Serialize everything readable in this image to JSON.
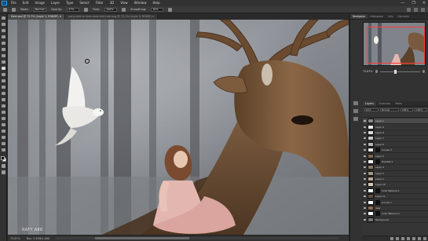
{
  "app": {
    "logo": "Ps",
    "menu": [
      "File",
      "Edit",
      "Image",
      "Layer",
      "Type",
      "Select",
      "Filter",
      "3D",
      "View",
      "Window",
      "Help"
    ],
    "window_controls": [
      "—",
      "❐",
      "✕"
    ]
  },
  "options_bar": {
    "mode_label": "Mode:",
    "mode_value": "Normal",
    "opacity_label": "Opacity:",
    "opacity_value": "47%",
    "flow_label": "Flow:",
    "flow_value": "100%",
    "smoothing_label": "Smoothing:",
    "smoothing_value": "10%"
  },
  "tabs": [
    {
      "label": "Deer.psd @ 75.7% (Layer 1, RGB/8*) ×",
      "active": true
    },
    {
      "label": "peng-bird-on-tree-dove-bird-tree.png @ 73.1% (Layer 0, RGB/8) ×",
      "active": false
    }
  ],
  "canvas": {
    "watermark": "RAFY A88",
    "accent_colors": {
      "fog": "#8c9096",
      "deer_fur": "#7a5a3f",
      "dress": "#e3b7b0",
      "dove": "#f1f1ef"
    }
  },
  "status": {
    "zoom": "75.67%",
    "doc_size": "Doc: 5.93M/1.46G"
  },
  "panels": {
    "top_tabs": [
      "Navigator",
      "Histogram",
      "Info",
      "Libraries"
    ],
    "zoom_value": "75.67%",
    "layers_tabs": [
      "Layers",
      "Channels",
      "Paths"
    ],
    "kind_filter": "Kind",
    "blend_mode": "Normal",
    "opacity": "100%",
    "fill": "100%",
    "layers": [
      {
        "name": "Layer 1",
        "selected": true,
        "thumb": "#8a8a8a",
        "mask": false
      },
      {
        "name": "Layer 9",
        "selected": false,
        "thumb": "#e9e9e9",
        "mask": false
      },
      {
        "name": "Layer 8",
        "selected": false,
        "thumb": "#d9d9d9",
        "mask": false
      },
      {
        "name": "Layer 7",
        "selected": false,
        "thumb": "#c7c7c7",
        "mask": false
      },
      {
        "name": "Layer 6",
        "selected": false,
        "thumb": "#b8b8b8",
        "mask": false
      },
      {
        "name": "Curves 3",
        "selected": false,
        "thumb": "#e8e8e8",
        "mask": true
      },
      {
        "name": "Layer 5",
        "selected": false,
        "thumb": "#7d6650",
        "mask": false
      },
      {
        "name": "Hue/Sat 2",
        "selected": false,
        "thumb": "#f2f2f2",
        "mask": true
      },
      {
        "name": "Layer 4",
        "selected": false,
        "thumb": "#8c7a66",
        "mask": false
      },
      {
        "name": "Layer 3",
        "selected": false,
        "thumb": "#a39583",
        "mask": false
      },
      {
        "name": "Layer 2",
        "selected": false,
        "thumb": "#b9a491",
        "mask": false
      },
      {
        "name": "Layer 10",
        "selected": false,
        "thumb": "#d4c8bc",
        "mask": false
      },
      {
        "name": "Color Balance 1",
        "selected": false,
        "thumb": "#ffffff",
        "mask": true
      },
      {
        "name": "Layer 11",
        "selected": false,
        "thumb": "#5e5147",
        "mask": false
      },
      {
        "name": "Curves 1",
        "selected": false,
        "thumb": "#ffffff",
        "mask": true
      },
      {
        "name": "deer",
        "selected": false,
        "thumb": "#8a6a4c",
        "mask": false
      },
      {
        "name": "Color Balance 2",
        "selected": false,
        "thumb": "#ffffff",
        "mask": true
      },
      {
        "name": "Background",
        "selected": false,
        "thumb": "#6e7278",
        "mask": false
      }
    ]
  }
}
